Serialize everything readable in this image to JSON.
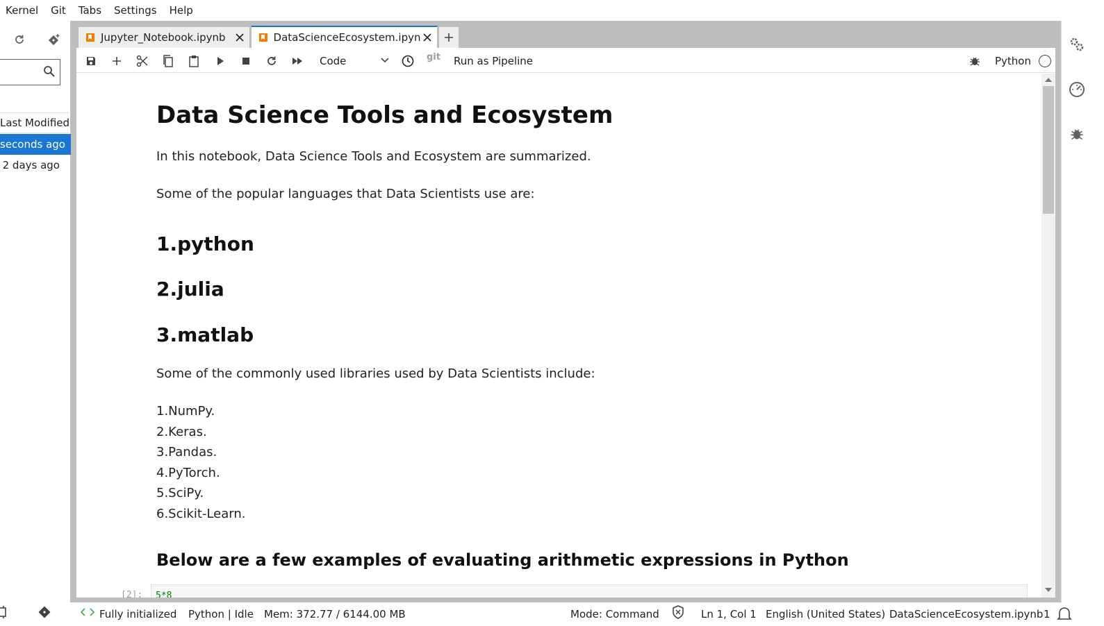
{
  "menubar": {
    "items": [
      "Kernel",
      "Git",
      "Tabs",
      "Settings",
      "Help"
    ]
  },
  "file_browser": {
    "search_placeholder": "",
    "column_header": "Last Modified",
    "rows": [
      {
        "modified": "seconds ago",
        "selected": true
      },
      {
        "modified": "2 days ago",
        "selected": false
      }
    ],
    "icons": [
      "refresh-icon",
      "git-clone-icon",
      "search-icon"
    ]
  },
  "tabs": [
    {
      "label": "Jupyter_Notebook.ipynb",
      "active": false
    },
    {
      "label": "DataScienceEcosystem.ipyn",
      "active": true
    }
  ],
  "toolbar": {
    "cell_type": "Code",
    "git_label": "git",
    "run_pipeline": "Run as Pipeline",
    "kernel": "Python",
    "icons": [
      "save-icon",
      "add-cell-icon",
      "cut-icon",
      "copy-icon",
      "paste-icon",
      "run-icon",
      "stop-icon",
      "restart-icon",
      "run-all-icon",
      "history-icon",
      "debugger-icon"
    ]
  },
  "notebook": {
    "title": "Data Science Tools and Ecosystem",
    "intro": "In this notebook, Data Science Tools and Ecosystem are summarized.",
    "languages_intro": "Some of the popular languages that Data Scientists use are:",
    "languages": [
      "1.python",
      "2.julia",
      "3.matlab"
    ],
    "libraries_intro": "Some of the commonly used libraries used by Data Scientists include:",
    "libraries": [
      "1.NumPy.",
      "2.Keras.",
      "3.Pandas.",
      "4.PyTorch.",
      "5.SciPy.",
      "6.Scikit-Learn."
    ],
    "arith_heading": "Below are a few examples of evaluating arithmetic expressions in Python",
    "code_prompt": "[2]:",
    "code_text": "5*8"
  },
  "right_sidebar": {
    "icons": [
      "property-inspector-icon",
      "resource-gauge-icon",
      "debugger-sidebar-icon"
    ]
  },
  "statusbar": {
    "init_status": "Fully initialized",
    "kernel_status": "Python | Idle",
    "memory": "Mem: 372.77 / 6144.00 MB",
    "mode": "Mode: Command",
    "cursor": "Ln 1, Col 1",
    "language": "English (United States)",
    "filename": "DataScienceEcosystem.ipynb",
    "notifications": "1"
  },
  "colors": {
    "accent": "#1976d2",
    "notebook_icon": "#f57c00",
    "toolbar_icon": "#616161"
  }
}
